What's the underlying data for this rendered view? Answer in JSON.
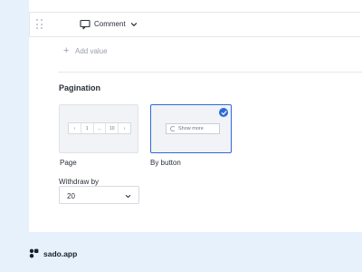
{
  "value_row": {
    "icon": "comment-icon",
    "label": "Comment",
    "dropdown_icon": "chevron-down-icon"
  },
  "add_value": {
    "icon": "plus-icon",
    "label": "Add value"
  },
  "pagination": {
    "title": "Pagination",
    "options": [
      {
        "label": "Page",
        "selected": false,
        "preview": {
          "items": [
            "‹",
            "1",
            "...",
            "10",
            "›"
          ]
        }
      },
      {
        "label": "By button",
        "selected": true,
        "preview": {
          "button_label": "Show more"
        }
      }
    ],
    "withdraw": {
      "label": "Withdraw by",
      "value": "20"
    }
  },
  "brand": {
    "name": "sado.app"
  },
  "colors": {
    "accent": "#2d6ad8",
    "page_bg": "#e6f1fc",
    "card_bg": "#ffffff"
  }
}
